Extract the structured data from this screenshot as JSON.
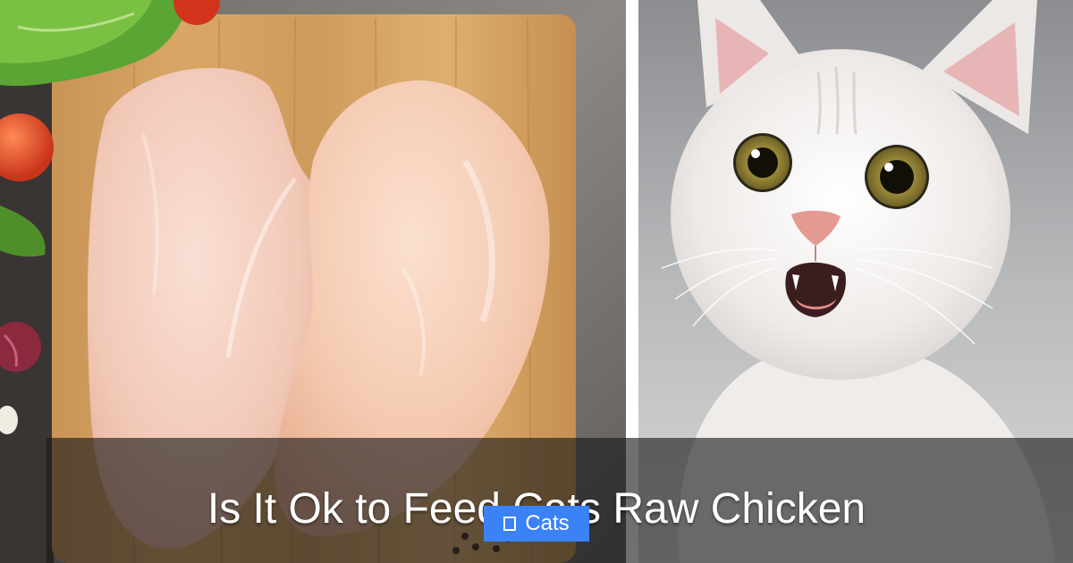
{
  "post": {
    "title": "Is It Ok to Feed Cats Raw Chicken",
    "category": {
      "label": "Cats",
      "icon": "category-icon",
      "color": "#3b82f6"
    }
  },
  "images": {
    "left": "raw-chicken-breasts-on-cutting-board",
    "right": "surprised-white-cat"
  }
}
